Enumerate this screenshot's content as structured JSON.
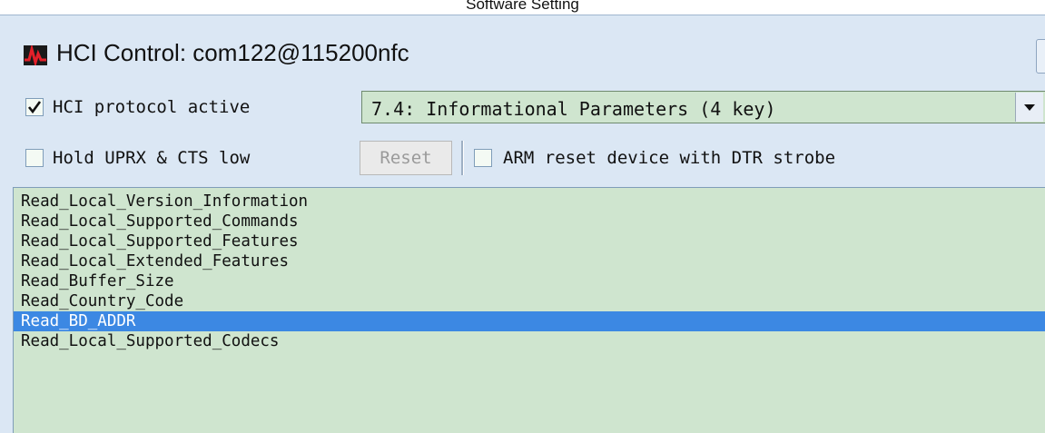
{
  "caption": "Software Setting",
  "window": {
    "title": "HCI Control: com122@115200nfc"
  },
  "controls": {
    "hci_active": {
      "label": "HCI protocol active",
      "checked": true
    },
    "command_group": {
      "selected": "7.4: Informational Parameters (4 key)"
    },
    "hold_uprx": {
      "label": "Hold UPRX & CTS low",
      "checked": false
    },
    "reset_button": {
      "label": "Reset",
      "enabled": false
    },
    "arm_reset": {
      "label": "ARM reset device with DTR strobe",
      "checked": false
    }
  },
  "commands": {
    "items": [
      "Read_Local_Version_Information",
      "Read_Local_Supported_Commands",
      "Read_Local_Supported_Features",
      "Read_Local_Extended_Features",
      "Read_Buffer_Size",
      "Read_Country_Code",
      "Read_BD_ADDR",
      "Read_Local_Supported_Codecs"
    ],
    "selected_index": 6
  },
  "colors": {
    "list_background": "#cfe5cf",
    "selection": "#3c88e3",
    "window_background": "#dbe7f4"
  },
  "icons": {
    "app": "waveform-app-icon",
    "check": "check-icon",
    "dropdown": "dropdown-arrow-icon"
  }
}
